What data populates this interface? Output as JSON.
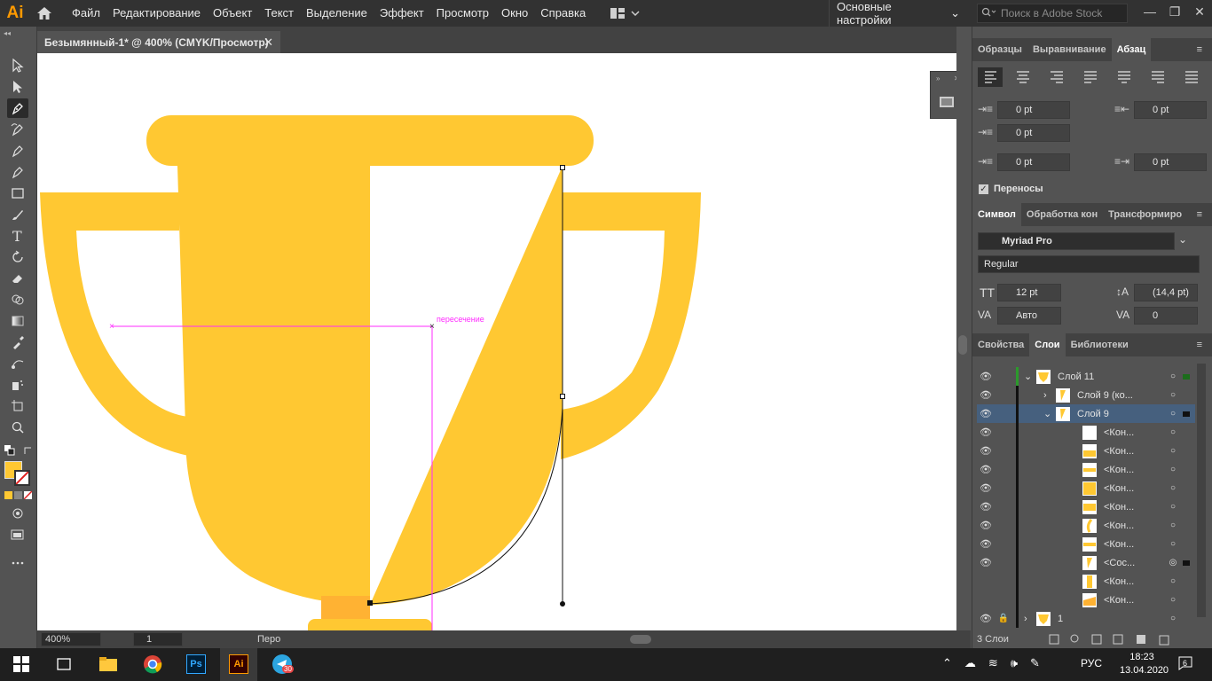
{
  "app": {
    "logo": "Ai",
    "accent": "#ff9a00"
  },
  "menu": [
    "Файл",
    "Редактирование",
    "Объект",
    "Текст",
    "Выделение",
    "Эффект",
    "Просмотр",
    "Окно",
    "Справка"
  ],
  "workspace": {
    "label": "Основные настройки"
  },
  "search": {
    "placeholder": "Поиск в Adobe Stock"
  },
  "document": {
    "tab_title": "Безымянный-1* @ 400% (CMYK/Просмотр)",
    "close": "✕"
  },
  "canvas": {
    "smart_guide_label": "пересечение",
    "fill_color": "#ffc832",
    "shadow_color": "#ffb233",
    "guide_color": "#ff2bff"
  },
  "status": {
    "zoom": "400%",
    "page": "1",
    "tool": "Перо"
  },
  "panels": {
    "top_tabs": [
      "Образцы",
      "Выравнивание",
      "Абзац"
    ],
    "paragraph": {
      "left_indent": "0 pt",
      "right_indent": "0 pt",
      "first_line_indent": "0 pt",
      "space_before": "0 pt",
      "space_after": "0 pt",
      "hyphenation_label": "Переносы",
      "hyphenation": true
    },
    "char_tabs": [
      "Символ",
      "Обработка кон",
      "Трансформиро"
    ],
    "character": {
      "font": "Myriad Pro",
      "style": "Regular",
      "size": "12 pt",
      "leading": "(14,4 pt)",
      "kerning": "Авто",
      "tracking": "0"
    },
    "layer_tabs": [
      "Свойства",
      "Слои",
      "Библиотеки"
    ],
    "layers": [
      {
        "name": "Слой 11",
        "indent": 0,
        "expanded": true,
        "thumb": "cup",
        "target": "filled-green"
      },
      {
        "name": "Слой 9 (ко...",
        "indent": 1,
        "expanded": false,
        "thumb": "piece",
        "target": "ring"
      },
      {
        "name": "Слой 9",
        "indent": 1,
        "expanded": true,
        "thumb": "piece",
        "target": "ring-selected",
        "selected": true
      },
      {
        "name": "<Кон...",
        "indent": 2,
        "thumb": "white",
        "target": "ring"
      },
      {
        "name": "<Кон...",
        "indent": 2,
        "thumb": "bowl",
        "target": "ring"
      },
      {
        "name": "<Кон...",
        "indent": 2,
        "thumb": "bar",
        "target": "ring"
      },
      {
        "name": "<Кон...",
        "indent": 2,
        "thumb": "fill",
        "target": "ring"
      },
      {
        "name": "<Кон...",
        "indent": 2,
        "thumb": "bar2",
        "target": "ring"
      },
      {
        "name": "<Кон...",
        "indent": 2,
        "thumb": "curve",
        "target": "ring"
      },
      {
        "name": "<Кон...",
        "indent": 2,
        "thumb": "bar",
        "target": "ring"
      },
      {
        "name": "<Сос...",
        "indent": 2,
        "thumb": "piece",
        "target": "double-ring"
      },
      {
        "name": "<Кон...",
        "indent": 2,
        "thumb": "stem",
        "target": "ring"
      },
      {
        "name": "<Кон...",
        "indent": 2,
        "thumb": "base",
        "target": "ring"
      },
      {
        "name": "1",
        "indent": 0,
        "expanded": false,
        "thumb": "cup",
        "target": "ring",
        "locked": true
      }
    ],
    "layers_count": "3 Слои"
  },
  "taskbar": {
    "apps": [
      "file-explorer",
      "chrome",
      "photoshop",
      "illustrator",
      "telegram"
    ],
    "ps_label": "Ps",
    "ai_label": "Ai",
    "tg_badge": "30",
    "language": "РУС",
    "time": "18:23",
    "date": "13.04.2020",
    "notifications": "6"
  }
}
